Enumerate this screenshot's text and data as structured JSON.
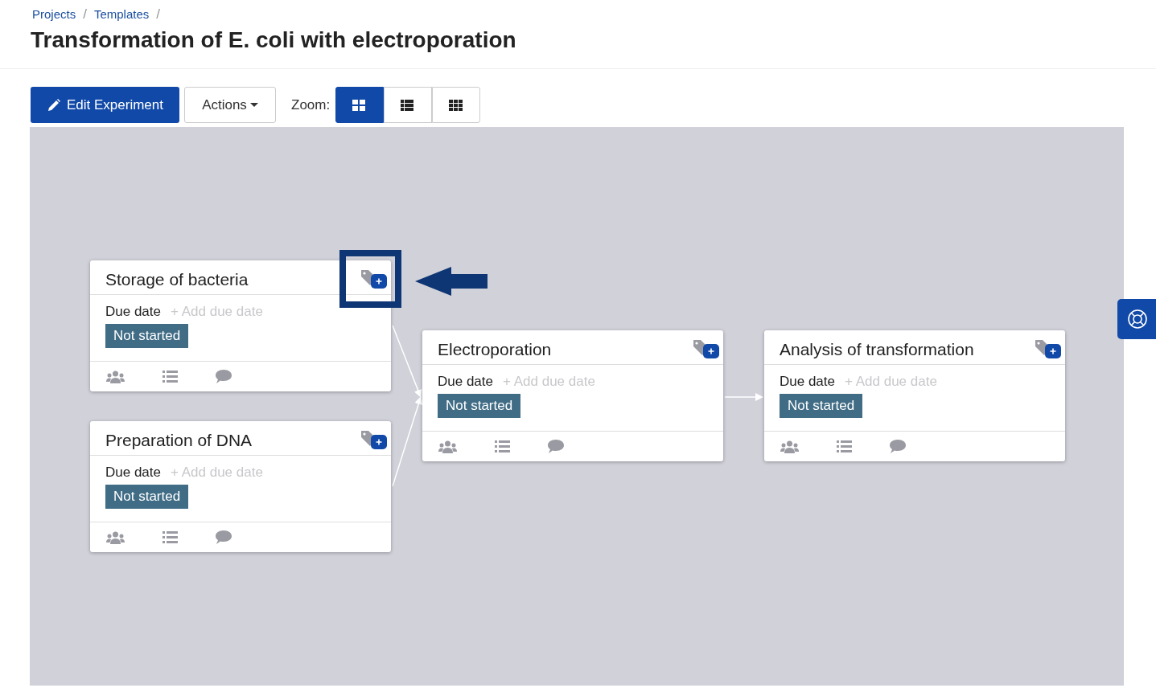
{
  "breadcrumbs": [
    {
      "label": "Projects",
      "separator": "/"
    },
    {
      "label": "Templates",
      "separator": "/"
    }
  ],
  "title": "Transformation of E. coli with electroporation",
  "toolbar": {
    "edit_button": "Edit Experiment",
    "actions_button": "Actions",
    "zoom_label": "Zoom:",
    "zoom_options": [
      {
        "kind": "large",
        "selected": true
      },
      {
        "kind": "medium",
        "selected": false
      },
      {
        "kind": "small",
        "selected": false
      }
    ]
  },
  "tasks": [
    {
      "name": "Storage of bacteria",
      "due_label": "Due date",
      "due_placeholder": "+ Add due date",
      "status": "Not started",
      "tag_highlighted": true
    },
    {
      "name": "Preparation of DNA",
      "due_label": "Due date",
      "due_placeholder": "+ Add due date",
      "status": "Not started",
      "tag_highlighted": false
    },
    {
      "name": "Electroporation",
      "due_label": "Due date",
      "due_placeholder": "+ Add due date",
      "status": "Not started",
      "tag_highlighted": false
    },
    {
      "name": "Analysis of transformation",
      "due_label": "Due date",
      "due_placeholder": "+ Add due date",
      "status": "Not started",
      "tag_highlighted": false
    }
  ]
}
